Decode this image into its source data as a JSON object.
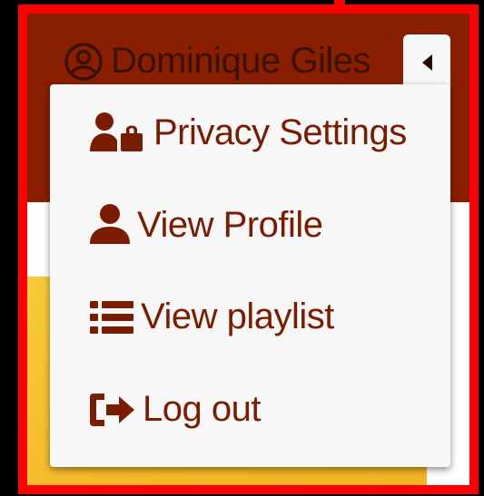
{
  "header": {
    "user_name": "Dominique Giles",
    "user_icon": "user-circle-icon",
    "toggle_icon": "caret-left-icon"
  },
  "menu": {
    "items": [
      {
        "label": "Privacy Settings",
        "icon": "user-lock-icon"
      },
      {
        "label": "View Profile",
        "icon": "user-icon"
      },
      {
        "label": "View playlist",
        "icon": "list-icon"
      },
      {
        "label": "Log out",
        "icon": "sign-out-icon"
      }
    ]
  },
  "colors": {
    "header_background": "#8a1e00",
    "menu_text": "#7a1c00",
    "menu_background": "#f7f7f7",
    "highlight_border": "#ff0000",
    "panel_yellow": "#f4b928"
  }
}
